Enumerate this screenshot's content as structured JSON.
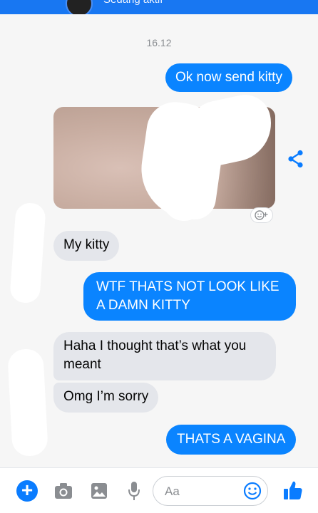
{
  "header": {
    "status_text": "Sedang aktif"
  },
  "thread": {
    "date_separator": "16.12",
    "messages": [
      {
        "side": "sent",
        "text": "Ok now send kitty"
      },
      {
        "side": "received",
        "text": "My kitty"
      },
      {
        "side": "sent",
        "text": "WTF THATS NOT LOOK LIKE A DAMN KITTY",
        "lines": [
          "WTF THATS NOT LOOK LIKE",
          "A DAMN KITTY"
        ]
      },
      {
        "side": "received",
        "text": "Haha I thought that’s what you meant",
        "lines": [
          "Haha I thought that’s what you",
          "meant"
        ]
      },
      {
        "side": "received",
        "text": "Omg I’m sorry"
      },
      {
        "side": "sent",
        "text": "THATS A VAGINA"
      }
    ]
  },
  "composer": {
    "placeholder": "Aa"
  },
  "colors": {
    "accent": "#0a84ff",
    "brand_bar": "#1877f2",
    "received_bubble": "#e4e6eb"
  },
  "icons": [
    "share-icon",
    "add-reaction-icon",
    "plus-icon",
    "camera-icon",
    "gallery-icon",
    "microphone-icon",
    "emoji-icon",
    "like-icon"
  ]
}
